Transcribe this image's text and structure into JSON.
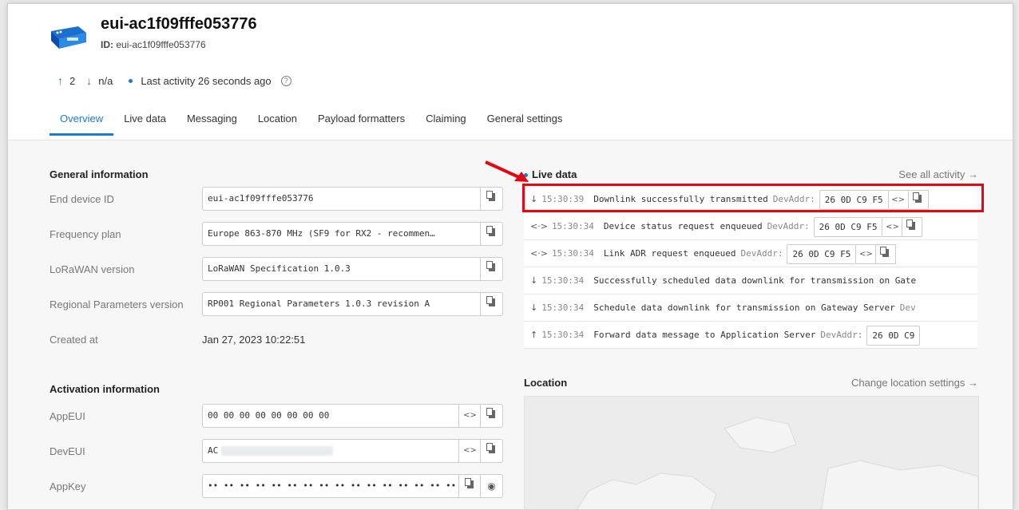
{
  "device": {
    "name": "eui-ac1f09fffe053776",
    "id_label": "ID:",
    "id_value": "eui-ac1f09fffe053776",
    "up_count": "2",
    "down_count": "n/a",
    "last_activity": "Last activity 26 seconds ago",
    "help_icon": "?"
  },
  "tabs": [
    "Overview",
    "Live data",
    "Messaging",
    "Location",
    "Payload formatters",
    "Claiming",
    "General settings"
  ],
  "general_info": {
    "title": "General information",
    "end_device_id_label": "End device ID",
    "end_device_id": "eui-ac1f09fffe053776",
    "frequency_plan_label": "Frequency plan",
    "frequency_plan": "Europe 863-870 MHz (SF9 for RX2 - recommen…",
    "lorawan_version_label": "LoRaWAN version",
    "lorawan_version": "LoRaWAN Specification 1.0.3",
    "regional_params_label": "Regional Parameters version",
    "regional_params": "RP001 Regional Parameters 1.0.3 revision A",
    "created_at_label": "Created at",
    "created_at": "Jan 27, 2023 10:22:51"
  },
  "activation_info": {
    "title": "Activation information",
    "appeui_label": "AppEUI",
    "appeui": "00 00 00 00 00 00 00 00",
    "deveui_label": "DevEUI",
    "deveui": "AC",
    "appkey_label": "AppKey",
    "appkey": "•• •• •• •• •• •• •• •• •• •• •• •• •• •• •• ••"
  },
  "live_data": {
    "title": "Live data",
    "see_all": "See all activity →",
    "events": [
      {
        "icon": "↓",
        "time": "15:30:39",
        "msg": "Downlink successfully transmitted",
        "key": "DevAddr:",
        "value": "26 0D C9 F5"
      },
      {
        "icon": "<·>",
        "time": "15:30:34",
        "msg": "Device status request enqueued",
        "key": "DevAddr:",
        "value": "26 0D C9 F5"
      },
      {
        "icon": "<·>",
        "time": "15:30:34",
        "msg": "Link ADR request enqueued",
        "key": "DevAddr:",
        "value": "26 0D C9 F5"
      },
      {
        "icon": "↓",
        "time": "15:30:34",
        "msg": "Successfully scheduled data downlink for transmission on Gate",
        "key": "",
        "value": ""
      },
      {
        "icon": "↓",
        "time": "15:30:34",
        "msg": "Schedule data downlink for transmission on Gateway Server",
        "key": "Dev",
        "value": ""
      },
      {
        "icon": "↑",
        "time": "15:30:34",
        "msg": "Forward data message to Application Server",
        "key": "DevAddr:",
        "value": "26 0D C9"
      }
    ]
  },
  "location": {
    "title": "Location",
    "link": "Change location settings →"
  },
  "colors": {
    "accent": "#1b7bd6",
    "highlight": "#e30613"
  }
}
